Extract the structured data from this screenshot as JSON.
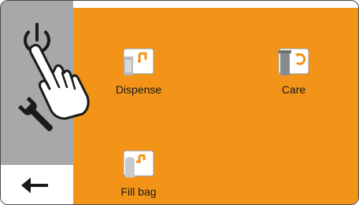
{
  "sidebar": {
    "power_icon": "power-icon",
    "settings_icon": "wrench-icon",
    "back_icon": "back-arrow-icon",
    "back_glyph": "←"
  },
  "menu": {
    "items": [
      {
        "label": "Dispense",
        "icon": "dispense-icon"
      },
      {
        "label": "Care",
        "icon": "care-icon"
      },
      {
        "label": "Fill bag",
        "icon": "fill-bag-icon"
      }
    ]
  },
  "colors": {
    "main_background": "#f39418",
    "sidebar_background": "#a7a8aa",
    "icon_gray": "#9a9b9d",
    "icon_orange": "#f39418"
  }
}
